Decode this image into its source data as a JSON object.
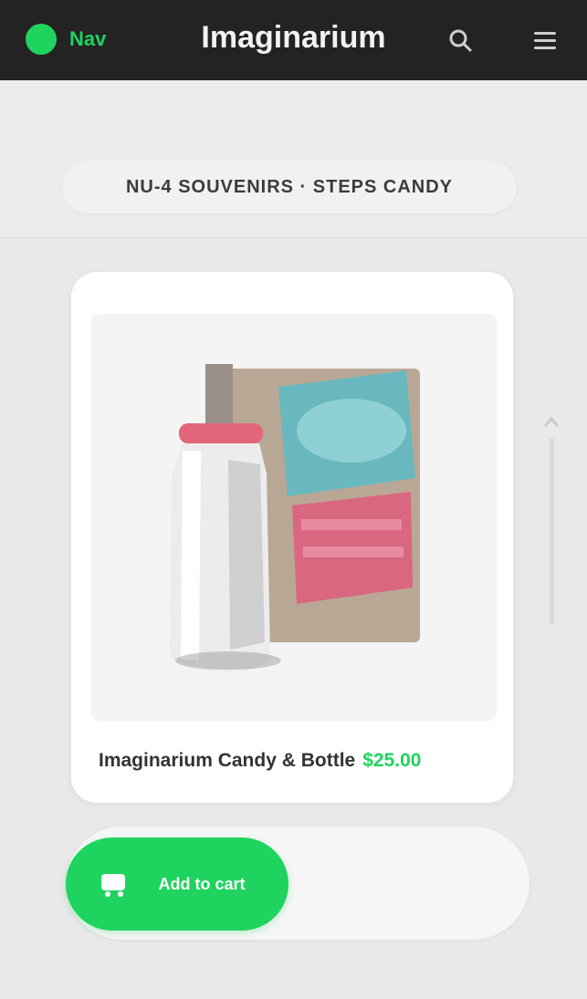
{
  "topbar": {
    "brand": "Nav",
    "title": "Imaginarium",
    "search_icon": "search-icon",
    "menu_icon": "menu-icon",
    "brand_color": "#1fd35f",
    "background": "#232323"
  },
  "breadcrumb": {
    "text": "NU-4 SOUVENIRS · STEPS CANDY"
  },
  "product": {
    "image_label": "product-photo",
    "name": "Imaginarium Candy & Bottle",
    "price": "$25.00"
  },
  "actions": {
    "buy_label": "Add to cart",
    "cart_icon": "cart-icon",
    "accent": "#1fd35f"
  }
}
